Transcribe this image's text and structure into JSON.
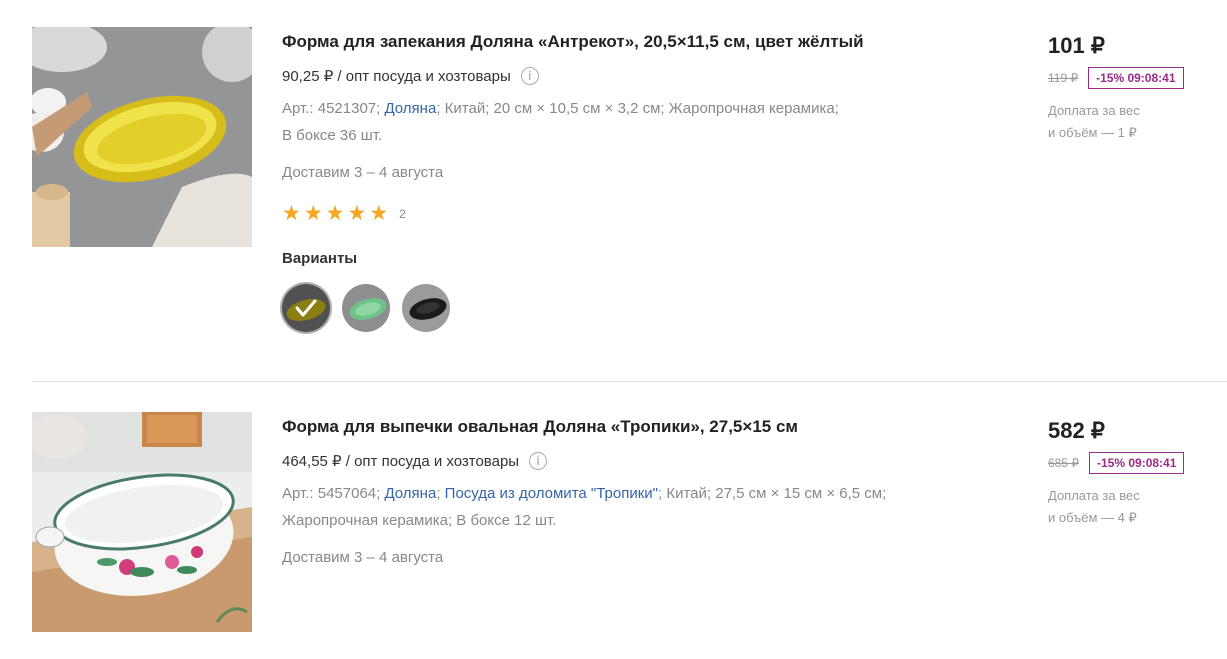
{
  "products": [
    {
      "title": "Форма для запекания Доляна «Антрекот», 20,5×11,5 см, цвет жёлтый",
      "wholesale": "90,25 ₽ / опт посуда и хозтовары",
      "info_icon": "i",
      "specs": {
        "art": "Арт.: 4521307;",
        "brand": "Доляна",
        "sep": ";",
        "country": "Китай;",
        "dims": "20 см × 10,5 см × 3,2 см;",
        "material": "Жаропрочная керамика;",
        "box": "В боксе 36 шт."
      },
      "delivery": "Доставим 3 – 4 августа",
      "rating": {
        "stars": 5,
        "count": "2",
        "star_glyph": "★"
      },
      "variants_title": "Варианты",
      "variants": [
        "yellow",
        "green",
        "black"
      ],
      "price": "101 ₽",
      "old_price": "119 ₽",
      "discount": "-15% 09:08:41",
      "extra_line1": "Доплата за вес",
      "extra_line2": "и объём — 1 ₽"
    },
    {
      "title": "Форма для выпечки овальная Доляна «Тропики», 27,5×15 см",
      "wholesale": "464,55 ₽ / опт посуда и хозтовары",
      "info_icon": "i",
      "specs": {
        "art": "Арт.: 5457064;",
        "brand": "Доляна",
        "sep": ";",
        "series": "Посуда из доломита \"Тропики\"",
        "country": "Китай;",
        "dims": "27,5 см × 15 см × 6,5 см;",
        "material": "Жаропрочная керамика;",
        "box": "В боксе 12 шт."
      },
      "delivery": "Доставим 3 – 4 августа",
      "price": "582 ₽",
      "old_price": "685 ₽",
      "discount": "-15% 09:08:41",
      "extra_line1": "Доплата за вес",
      "extra_line2": "и объём — 4 ₽"
    }
  ],
  "colors": {
    "brand_link": "#3565a8",
    "discount": "#9c2b8a",
    "star": "#f5a623"
  }
}
